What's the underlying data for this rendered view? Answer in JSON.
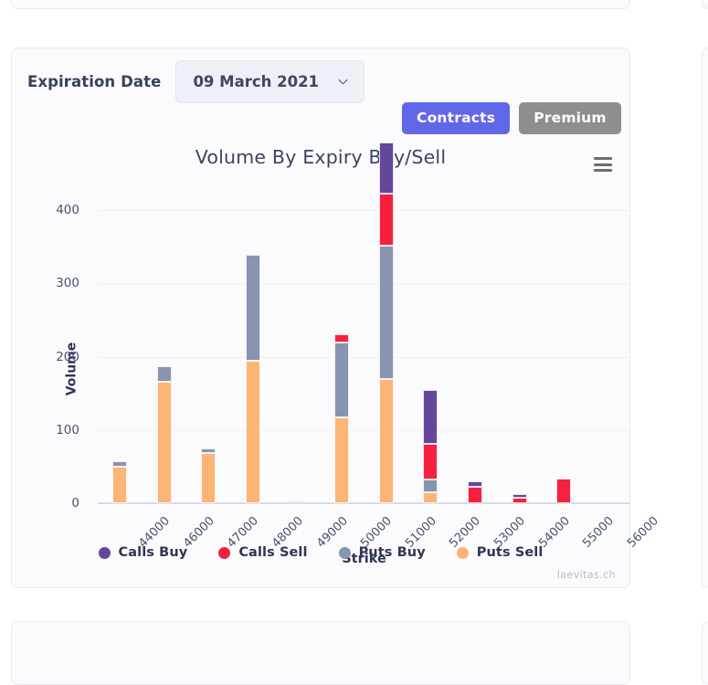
{
  "cards": {
    "top_partial": "",
    "right_partial": ""
  },
  "expiration": {
    "label": "Expiration Date",
    "selected": "09 March 2021",
    "chevron_icon": "chevron-down-icon"
  },
  "toggles": {
    "contracts": "Contracts",
    "premium": "Premium",
    "active": "Contracts",
    "active_color": "#6067e8",
    "inactive_color": "#8e8e8e"
  },
  "menu": {
    "icon": "hamburger-menu-icon"
  },
  "watermark": "laevitas.ch",
  "chart_data": {
    "type": "bar",
    "stacked": true,
    "title": "Volume By Expiry Buy/Sell",
    "xlabel": "Strike",
    "ylabel": "Volume",
    "ylim": [
      0,
      430
    ],
    "yticks": [
      0,
      100,
      200,
      300,
      400
    ],
    "grid": true,
    "legend_position": "bottom",
    "categories": [
      "44000",
      "46000",
      "47000",
      "48000",
      "49000",
      "50000",
      "51000",
      "52000",
      "53000",
      "54000",
      "55000",
      "56000"
    ],
    "series": [
      {
        "name": "Calls Buy",
        "color": "#62479a",
        "values": [
          0,
          0,
          0,
          0,
          3,
          0,
          70,
          74,
          8,
          5,
          0,
          0
        ]
      },
      {
        "name": "Calls Sell",
        "color": "#f5213f",
        "values": [
          0,
          0,
          0,
          0,
          0,
          10,
          70,
          48,
          22,
          8,
          34,
          0
        ]
      },
      {
        "name": "Puts Buy",
        "color": "#8894b0",
        "values": [
          7,
          21,
          7,
          145,
          0,
          103,
          182,
          18,
          0,
          0,
          0,
          0
        ]
      },
      {
        "name": "Puts Sell",
        "color": "#fcb477",
        "values": [
          50,
          166,
          68,
          194,
          0,
          117,
          170,
          15,
          0,
          0,
          0,
          0
        ]
      }
    ],
    "totals": [
      57,
      187,
      75,
      339,
      3,
      230,
      492,
      155,
      30,
      13,
      34,
      0
    ]
  }
}
